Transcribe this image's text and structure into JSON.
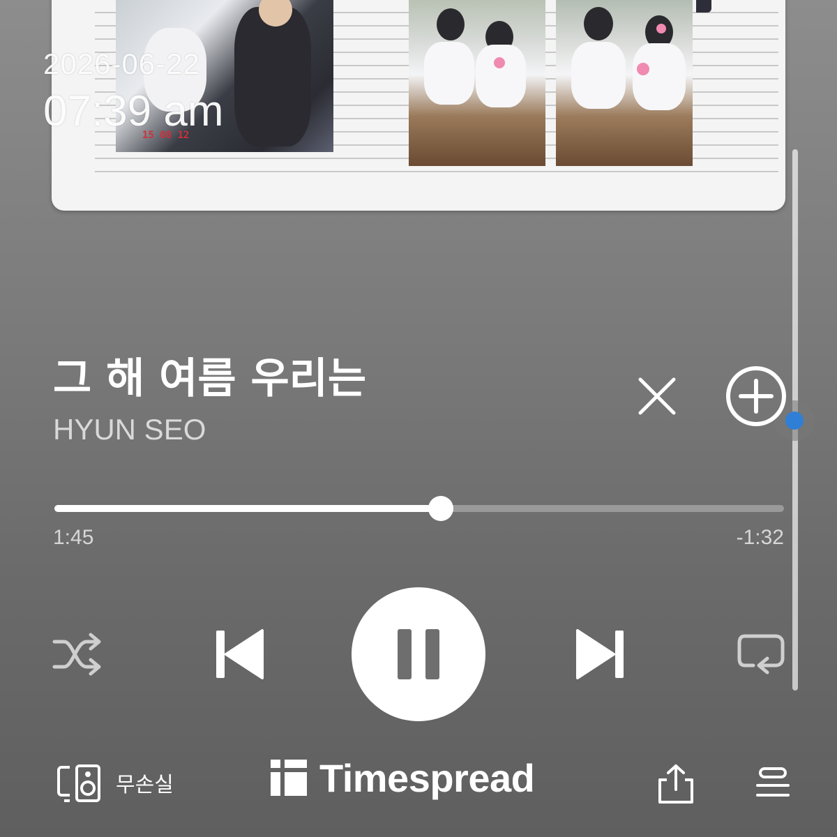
{
  "overlay": {
    "date": "2026-06-22",
    "time": "07:39 am"
  },
  "album_art": {
    "stamp": "15 08 12"
  },
  "track": {
    "title": "그 해 여름 우리는",
    "artist": "HYUN SEO"
  },
  "progress": {
    "elapsed": "1:45",
    "remaining": "-1:32",
    "fraction": 0.53
  },
  "controls": {
    "shuffle_icon": "shuffle-icon",
    "prev_icon": "skip-previous-icon",
    "play_state": "pause-icon",
    "next_icon": "skip-next-icon",
    "repeat_icon": "repeat-icon",
    "close_icon": "close-icon",
    "add_icon": "add-circle-icon"
  },
  "bottom_bar": {
    "device_label": "무손실",
    "brand": "Timespread",
    "share_icon": "share-icon",
    "queue_icon": "queue-icon"
  },
  "colors": {
    "accent_dot": "#2f7fd6",
    "foreground": "#ffffff"
  }
}
